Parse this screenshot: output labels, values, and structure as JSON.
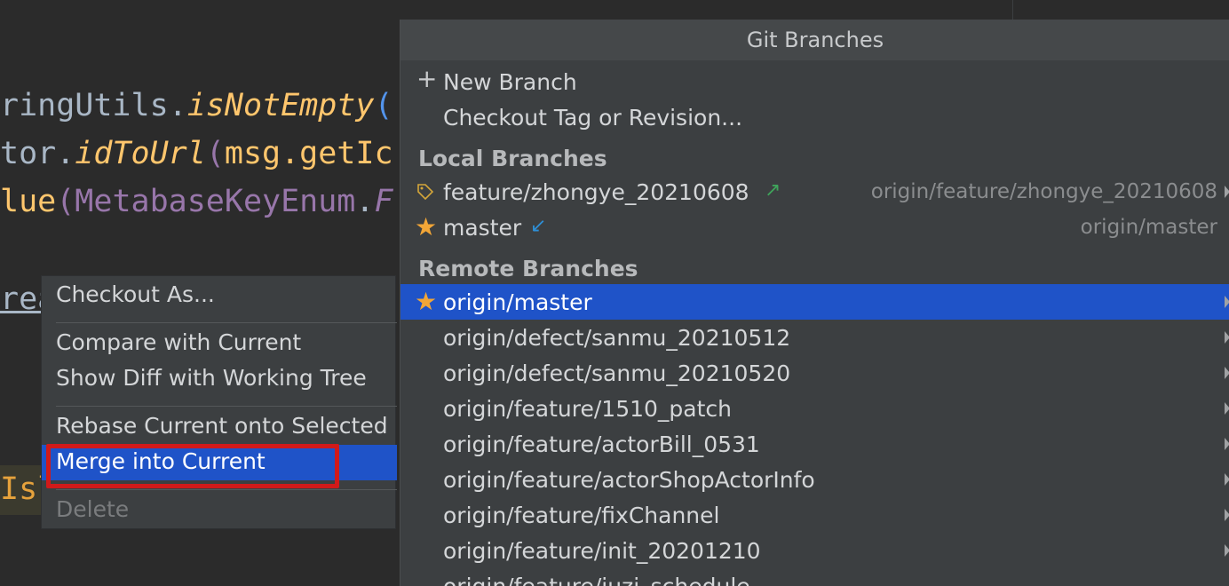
{
  "editor": {
    "lines": [
      {
        "a": "ringUtils",
        "b": ".",
        "c": "isNotEmpty",
        "d": "("
      },
      {
        "a": "tor",
        "b": ".",
        "c": "idToUrl",
        "d": "(",
        "e": "msg.getIc"
      },
      {
        "a": "lue",
        "b": "(",
        "c": "MetabaseKeyEnum",
        "d": ".",
        "e": "F"
      }
    ],
    "line4": "rea",
    "line5": "Isl"
  },
  "popup": {
    "title": "Git Branches",
    "actions": [
      {
        "label": "New Branch",
        "icon": "plus-icon"
      },
      {
        "label": "Checkout Tag or Revision..."
      }
    ],
    "local_section": "Local Branches",
    "local": [
      {
        "name": "feature/zhongye_20210608",
        "icon": "tag-icon",
        "status": "outgoing-arrow-icon",
        "tracking": "origin/feature/zhongye_20210608"
      },
      {
        "name": "master",
        "icon": "star-icon",
        "status": "incoming-arrow-icon",
        "tracking": "origin/master"
      }
    ],
    "remote_section": "Remote Branches",
    "remote": [
      {
        "name": "origin/master",
        "favorite": true,
        "selected": true
      },
      {
        "name": "origin/defect/sanmu_20210512"
      },
      {
        "name": "origin/defect/sanmu_20210520"
      },
      {
        "name": "origin/feature/1510_patch"
      },
      {
        "name": "origin/feature/actorBill_0531"
      },
      {
        "name": "origin/feature/actorShopActorInfo"
      },
      {
        "name": "origin/feature/fixChannel"
      },
      {
        "name": "origin/feature/init_20201210"
      },
      {
        "name": "origin/feature/juzi_schedule"
      }
    ],
    "colors": {
      "selection": "#1f53c8",
      "star": "#f2a637",
      "outgoing": "#3fa45b",
      "incoming": "#2e8fd6"
    }
  },
  "context_menu": {
    "items": [
      {
        "label": "Checkout As..."
      },
      {
        "label": "Compare with Current"
      },
      {
        "label": "Show Diff with Working Tree"
      },
      {
        "label": "Rebase Current onto Selected"
      },
      {
        "label": "Merge into Current",
        "selected": true,
        "highlighted": true
      },
      {
        "label": "Delete",
        "disabled": true
      }
    ],
    "highlight_color": "#d11a1a"
  }
}
